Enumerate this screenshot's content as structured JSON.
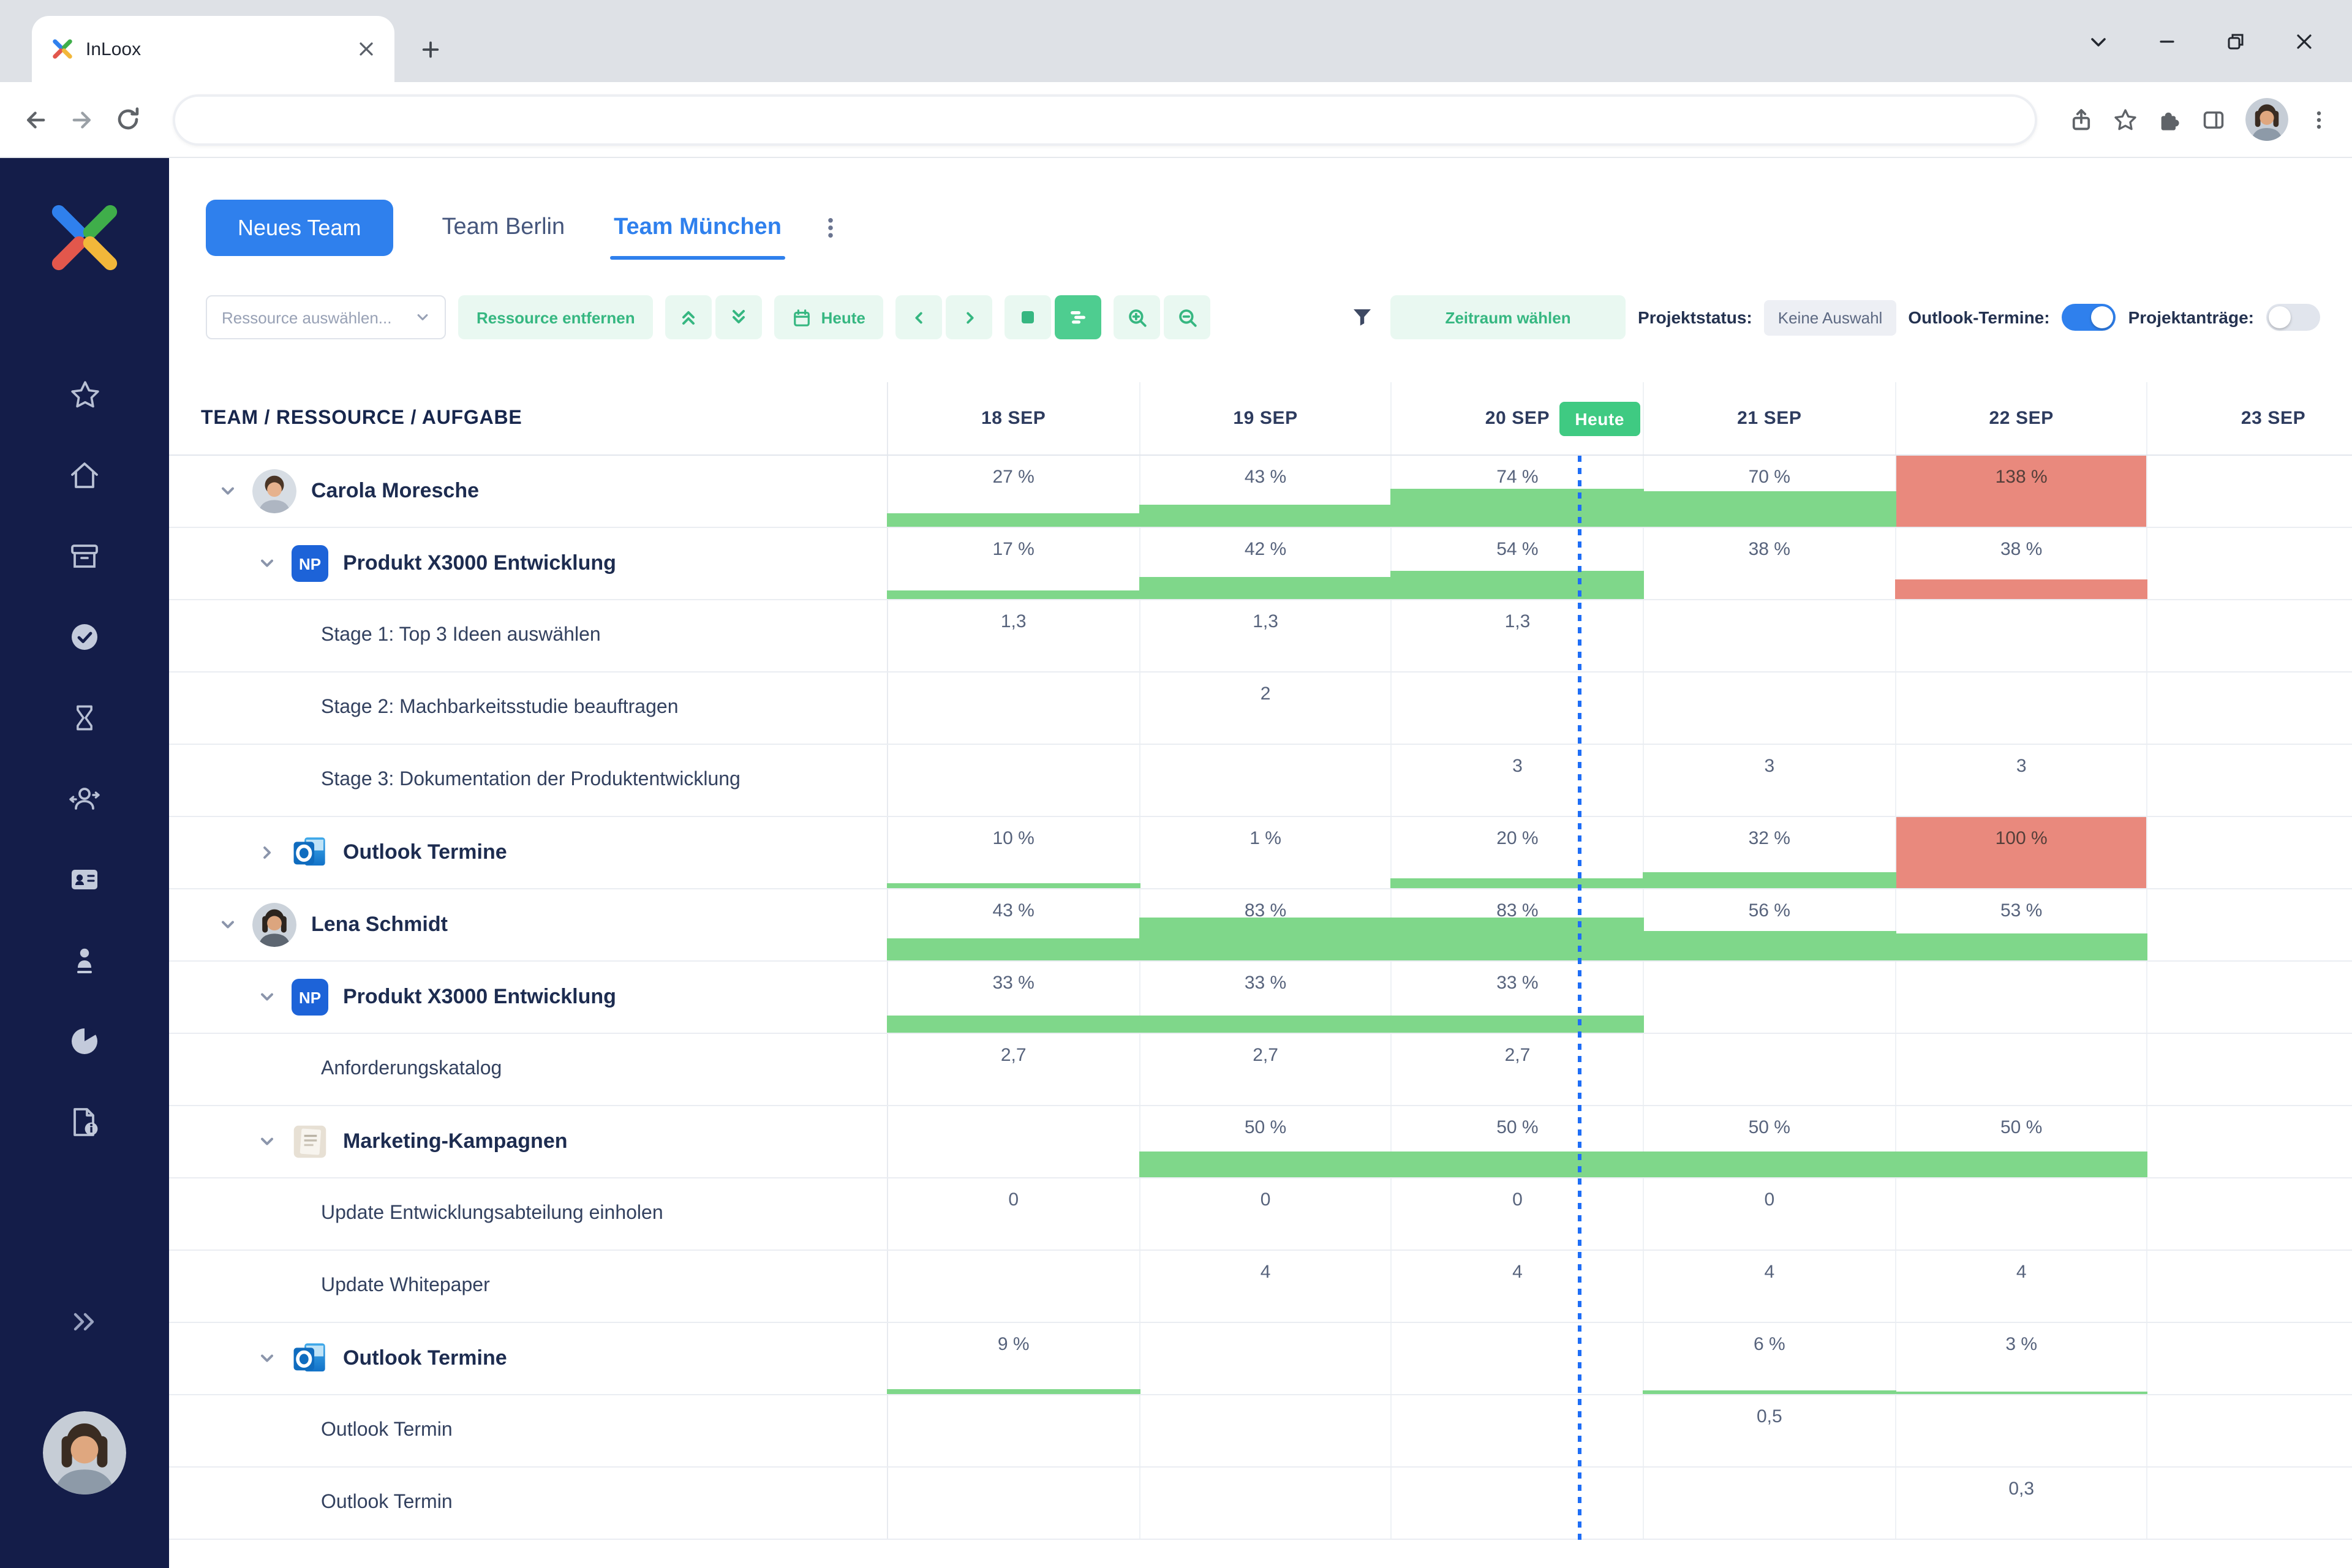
{
  "browser": {
    "tab_title": "InLoox",
    "address_value": ""
  },
  "icons": {
    "np_label": "NP",
    "sidebar": [
      "star-icon",
      "home-icon",
      "archive-icon",
      "check-circle-icon",
      "hourglass-icon",
      "people-sync-icon",
      "contact-card-icon",
      "person-icon",
      "pie-chart-icon",
      "document-info-icon"
    ]
  },
  "team_bar": {
    "new_team_button": "Neues Team",
    "tabs": [
      {
        "label": "Team Berlin",
        "active": false
      },
      {
        "label": "Team München",
        "active": true
      }
    ]
  },
  "toolbar": {
    "resource_select": "Ressource auswählen...",
    "remove_button": "Ressource entfernen",
    "today_button": "Heute",
    "range_button": "Zeitraum wählen",
    "project_status_label": "Projektstatus:",
    "project_status_value": "Keine Auswahl",
    "outlook_toggle_label": "Outlook-Termine:",
    "outlook_toggle_on": true,
    "requests_toggle_label": "Projektanträge:",
    "requests_toggle_on": false
  },
  "grid": {
    "left_header": "TEAM / RESSOURCE / AUFGABE",
    "dates": [
      "18 SEP",
      "19 SEP",
      "20 SEP",
      "21 SEP",
      "22 SEP",
      "23 SEP"
    ],
    "today_badge": "Heute",
    "today_col": 2,
    "rows": [
      {
        "type": "person",
        "chevron": "down",
        "avatar": "carola",
        "label": "Carola Moresche",
        "cells": [
          {
            "v": "27 %",
            "bar": 27
          },
          {
            "v": "43 %",
            "bar": 43
          },
          {
            "v": "74 %",
            "bar": 74
          },
          {
            "v": "70 %",
            "bar": 70
          },
          {
            "v": "138 %",
            "full": true
          },
          null
        ]
      },
      {
        "type": "project",
        "chevron": "down",
        "icon": "np",
        "label": "Produkt X3000 Entwicklung",
        "cells": [
          {
            "v": "17 %",
            "bar": 17
          },
          {
            "v": "42 %",
            "bar": 42
          },
          {
            "v": "54 %",
            "bar": 54
          },
          {
            "v": "38 %"
          },
          {
            "v": "38 %",
            "bar": 38,
            "red": true
          },
          null
        ]
      },
      {
        "type": "task",
        "label": "Stage 1: Top 3 Ideen auswählen",
        "cells": [
          {
            "v": "1,3"
          },
          {
            "v": "1,3"
          },
          {
            "v": "1,3"
          },
          null,
          null,
          null
        ]
      },
      {
        "type": "task",
        "label": "Stage 2: Machbarkeitsstudie beauftragen",
        "cells": [
          null,
          {
            "v": "2"
          },
          null,
          null,
          null,
          null
        ]
      },
      {
        "type": "task",
        "label": "Stage 3: Dokumentation der Produktentwicklung",
        "cells": [
          null,
          null,
          {
            "v": "3"
          },
          {
            "v": "3"
          },
          {
            "v": "3"
          },
          null
        ]
      },
      {
        "type": "project",
        "chevron": "right",
        "icon": "outlook",
        "label": "Outlook Termine",
        "cells": [
          {
            "v": "10 %",
            "bar": 10
          },
          {
            "v": "1 %"
          },
          {
            "v": "20 %",
            "bar": 20
          },
          {
            "v": "32 %",
            "bar": 32
          },
          {
            "v": "100 %",
            "full": true
          },
          null
        ]
      },
      {
        "type": "person",
        "chevron": "down",
        "avatar": "lena",
        "label": "Lena Schmidt",
        "cells": [
          {
            "v": "43 %",
            "bar": 43
          },
          {
            "v": "83 %",
            "bar": 83
          },
          {
            "v": "83 %",
            "bar": 83
          },
          {
            "v": "56 %",
            "bar": 56
          },
          {
            "v": "53 %",
            "bar": 53
          },
          null
        ]
      },
      {
        "type": "project",
        "chevron": "down",
        "icon": "np",
        "label": "Produkt X3000 Entwicklung",
        "cells": [
          {
            "v": "33 %",
            "bar": 33
          },
          {
            "v": "33 %",
            "bar": 33
          },
          {
            "v": "33 %",
            "bar": 33
          },
          null,
          null,
          null
        ]
      },
      {
        "type": "task",
        "label": "Anforderungskatalog",
        "cells": [
          {
            "v": "2,7"
          },
          {
            "v": "2,7"
          },
          {
            "v": "2,7"
          },
          null,
          null,
          null
        ]
      },
      {
        "type": "project",
        "chevron": "down",
        "icon": "document",
        "label": "Marketing-Kampagnen",
        "cells": [
          null,
          {
            "v": "50 %",
            "bar": 50
          },
          {
            "v": "50 %",
            "bar": 50
          },
          {
            "v": "50 %",
            "bar": 50
          },
          {
            "v": "50 %",
            "bar": 50
          },
          null
        ]
      },
      {
        "type": "task",
        "label": "Update Entwicklungsabteilung einholen",
        "cells": [
          {
            "v": "0"
          },
          {
            "v": "0"
          },
          {
            "v": "0"
          },
          {
            "v": "0"
          },
          null,
          null
        ]
      },
      {
        "type": "task",
        "label": "Update Whitepaper",
        "cells": [
          null,
          {
            "v": "4"
          },
          {
            "v": "4"
          },
          {
            "v": "4"
          },
          {
            "v": "4"
          },
          null
        ]
      },
      {
        "type": "project",
        "chevron": "down",
        "icon": "outlook",
        "label": "Outlook Termine",
        "cells": [
          {
            "v": "9 %",
            "bar": 9
          },
          null,
          null,
          {
            "v": "6 %",
            "bar": 6
          },
          {
            "v": "3 %",
            "bar": 3
          },
          null
        ]
      },
      {
        "type": "task",
        "label": "Outlook Termin",
        "cells": [
          null,
          null,
          null,
          {
            "v": "0,5"
          },
          null,
          null
        ]
      },
      {
        "type": "task",
        "label": "Outlook Termin",
        "cells": [
          null,
          null,
          null,
          null,
          {
            "v": "0,3"
          },
          null
        ]
      }
    ]
  },
  "colors": {
    "accent_green": "#3fca82",
    "bar_green": "#7fd78a",
    "overload_red": "#e9897d",
    "accent_blue": "#2f80ed",
    "sidebar_navy": "#141d49",
    "mint_bg": "#e9f8f1",
    "mint_text": "#36b781"
  }
}
